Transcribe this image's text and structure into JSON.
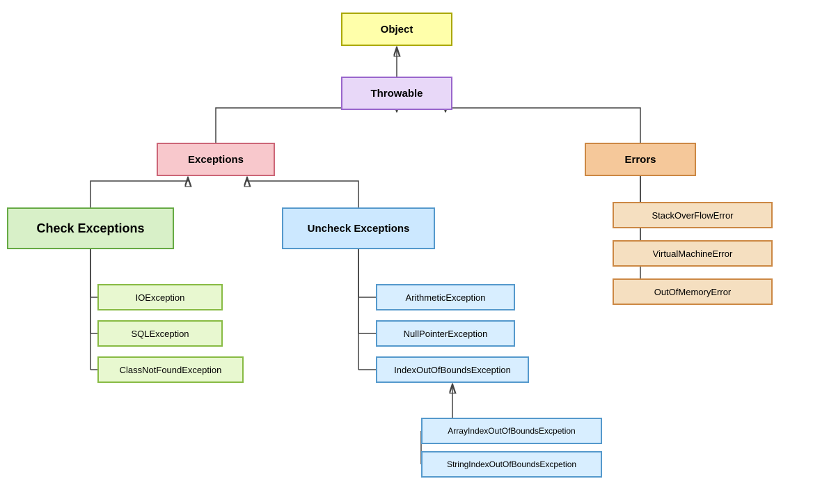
{
  "nodes": {
    "object": "Object",
    "throwable": "Throwable",
    "exceptions": "Exceptions",
    "errors": "Errors",
    "check": "Check Exceptions",
    "uncheck": "Uncheck Exceptions",
    "ioexception": "IOException",
    "sqlexception": "SQLException",
    "classnotfound": "ClassNotFoundException",
    "arithmetic": "ArithmeticException",
    "nullpointer": "NullPointerException",
    "indexoutofbounds": "IndexOutOfBoundsException",
    "arrayindex": "ArrayIndexOutOfBoundsExcpetion",
    "stringindex": "StringIndexOutOfBoundsExcpetion",
    "stackoverflow": "StackOverFlowError",
    "virtualmachine": "VirtualMachineError",
    "outofmemory": "OutOfMemoryError"
  }
}
